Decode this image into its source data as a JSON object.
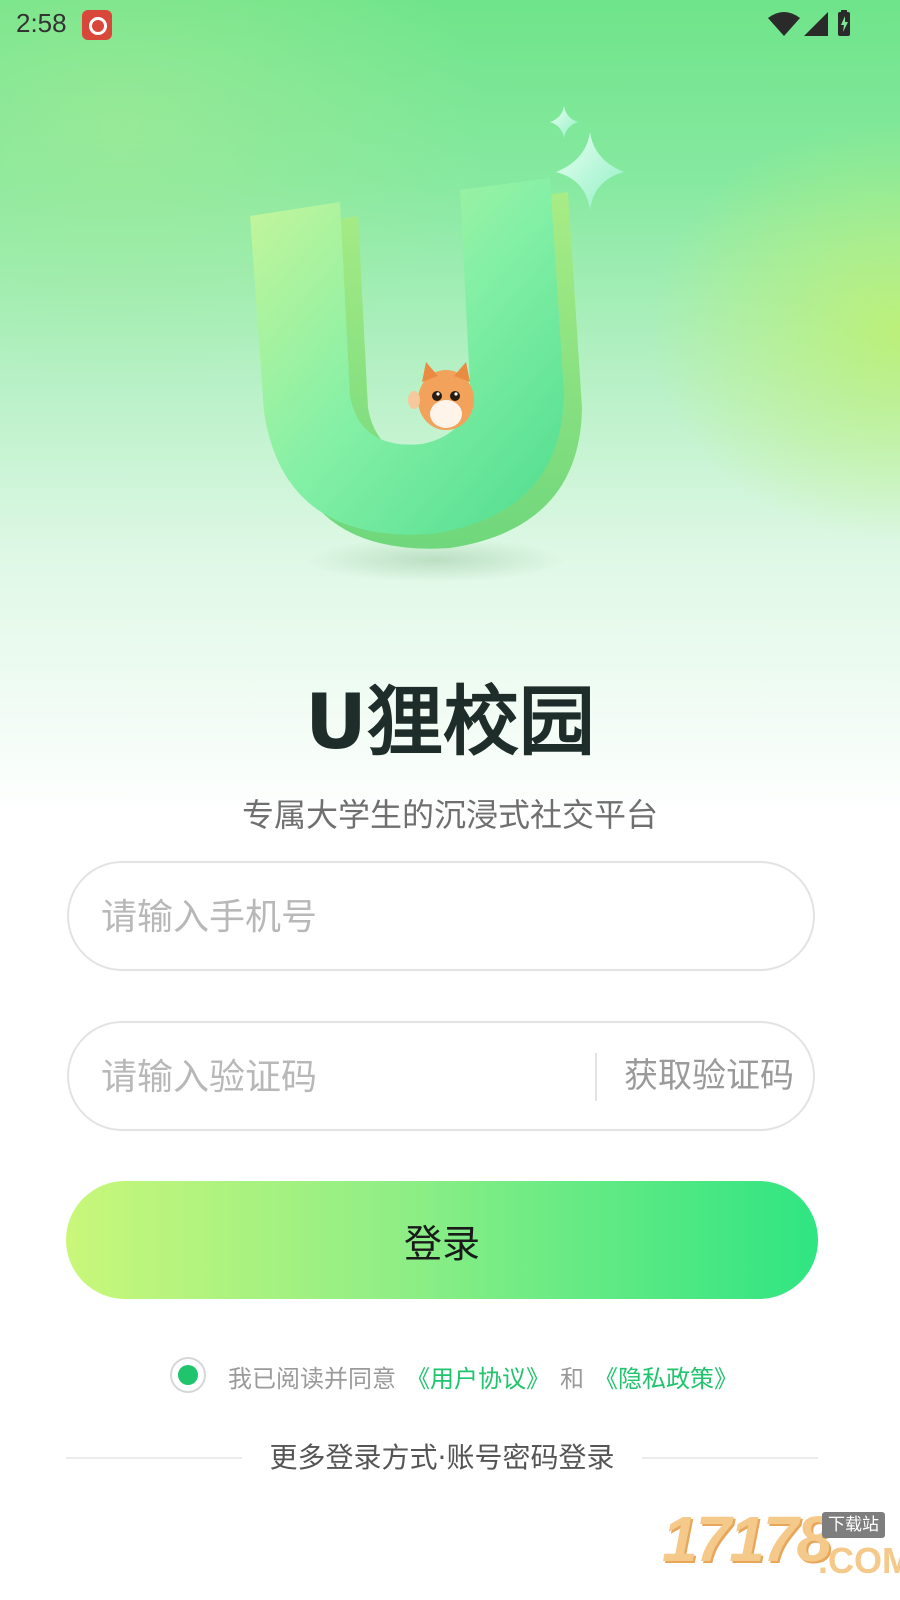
{
  "status_bar": {
    "time": "2:58"
  },
  "app": {
    "title": "U狸校园",
    "subtitle": "专属大学生的沉浸式社交平台"
  },
  "form": {
    "phone_placeholder": "请输入手机号",
    "code_placeholder": "请输入验证码",
    "get_code_label": "获取验证码",
    "login_label": "登录"
  },
  "agreement": {
    "checked": true,
    "prefix": "我已阅读并同意",
    "user_agreement": "《用户协议》",
    "and": "和",
    "privacy_policy": "《隐私政策》"
  },
  "more_login": {
    "label": "更多登录方式",
    "separator": "·",
    "password_login": "账号密码登录"
  },
  "watermark": {
    "number": "17178",
    "tag": "下载站",
    "suffix": ".COM"
  },
  "colors": {
    "accent_green": "#1fc46c",
    "button_gradient_start": "#c9f77a",
    "button_gradient_end": "#2fe582",
    "title_color": "#1f2d2a"
  },
  "icons": [
    "app-notification-icon",
    "wifi-icon",
    "signal-icon",
    "battery-charging-icon",
    "u-logo-icon",
    "sparkle-icon",
    "cat-mascot-icon"
  ]
}
